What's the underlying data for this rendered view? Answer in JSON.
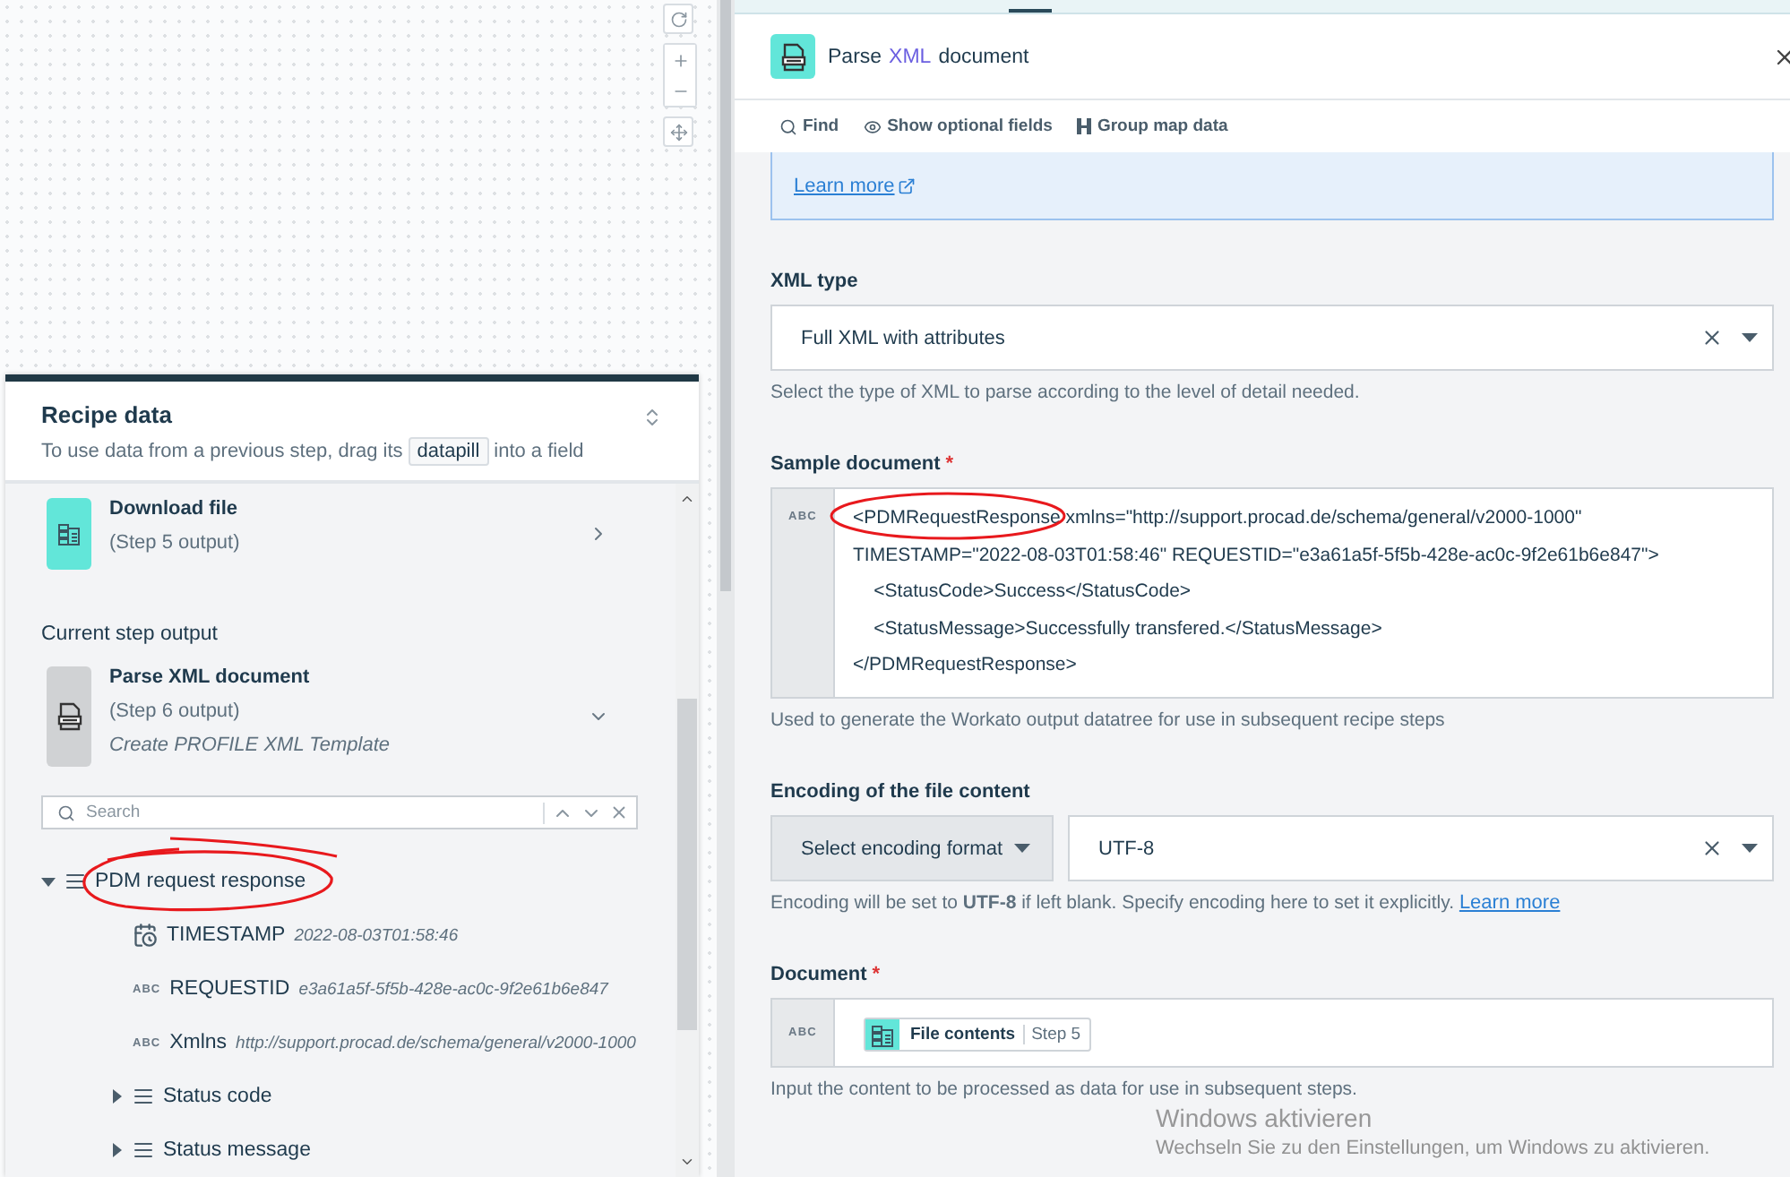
{
  "recipe_data": {
    "title": "Recipe data",
    "subtitle_before": "To use data from a previous step, drag its",
    "datapill": "datapill",
    "subtitle_after": "into a field",
    "previous_steps": [
      {
        "title": "Download file",
        "step": "(Step 5 output)"
      }
    ],
    "current_label": "Current step output",
    "current_step": {
      "title": "Parse XML document",
      "step": "(Step 6 output)",
      "description": "Create PROFILE XML Template",
      "expanded": true
    },
    "search": {
      "placeholder": "Search"
    },
    "tree": [
      {
        "kind": "object",
        "label": "PDM request response",
        "expanded": true,
        "children": [
          {
            "kind": "datetime",
            "label": "TIMESTAMP",
            "sample": "2022-08-03T01:58:46"
          },
          {
            "kind": "string",
            "type_badge": "ABC",
            "label": "REQUESTID",
            "sample": "e3a61a5f-5f5b-428e-ac0c-9f2e61b6e847"
          },
          {
            "kind": "string",
            "type_badge": "ABC",
            "label": "Xmlns",
            "sample": "http://support.procad.de/schema/general/v2000-1000"
          },
          {
            "kind": "object",
            "label": "Status code",
            "expanded": false
          },
          {
            "kind": "object",
            "label": "Status message",
            "expanded": false
          }
        ]
      }
    ]
  },
  "step_panel": {
    "title_parts": [
      {
        "text": "Parse",
        "highlighted": false
      },
      {
        "text": "XML",
        "highlighted": true
      },
      {
        "text": "document",
        "highlighted": false
      }
    ],
    "toolbar": [
      "Find",
      "Show optional fields",
      "Group map data"
    ],
    "info_link": "Learn more",
    "fields": [
      {
        "kind": "select",
        "label": "XML type",
        "value": "Full XML with attributes",
        "hint": "Select the type of XML to parse according to the level of detail needed."
      },
      {
        "kind": "textarea",
        "label": "Sample document",
        "required_mark": "*",
        "type_badge": "ABC",
        "value": "<PDMRequestResponse xmlns=\"http://support.procad.de/schema/general/v2000-1000\" TIMESTAMP=\"2022-08-03T01:58:46\" REQUESTID=\"e3a61a5f-5f5b-428e-ac0c-9f2e61b6e847\">\n    <StatusCode>Success</StatusCode>\n    <StatusMessage>Successfully transfered.</StatusMessage>\n</PDMRequestResponse>",
        "hint": "Used to generate the Workato output datatree for use in subsequent recipe steps"
      },
      {
        "kind": "encoding",
        "label": "Encoding of the file content",
        "mode": "Select encoding format",
        "value": "UTF-8",
        "hint": "Encoding will be set to **UTF-8** if left blank. Specify encoding here to set it explicitly.",
        "hint_link": "Learn more"
      },
      {
        "kind": "pill",
        "label": "Document",
        "required_mark": "*",
        "type_badge": "ABC",
        "pill": "File contents",
        "pill_step": "Step 5",
        "hint": "Input the content to be processed as data for use in subsequent steps."
      }
    ]
  },
  "os_notice": {
    "title": "Windows aktivieren",
    "text": "Wechseln Sie zu den Einstellungen, um Windows zu aktivieren."
  }
}
